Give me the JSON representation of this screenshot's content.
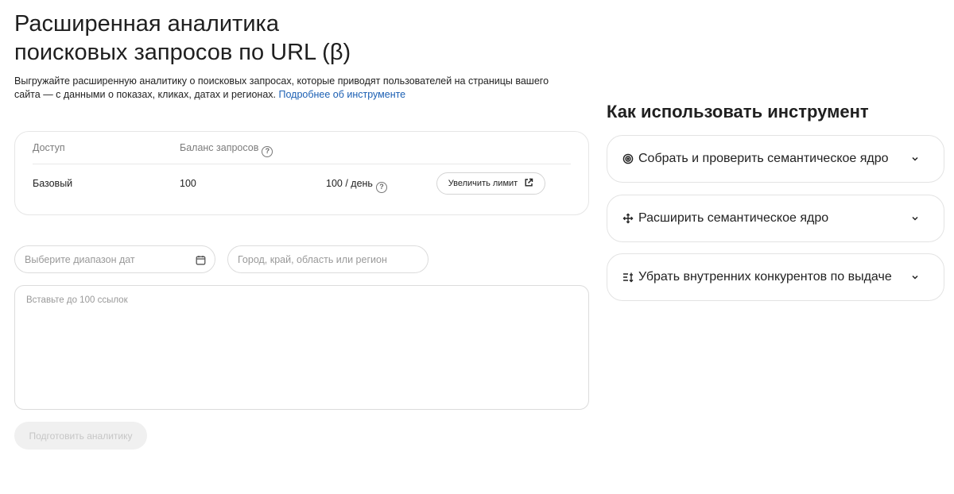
{
  "page": {
    "title_line1": "Расширенная аналитика",
    "title_line2": "поисковых запросов по URL (β)",
    "description": "Выгружайте расширенную аналитику о поисковых запросах, которые приводят пользователей на страницы вашего сайта — с данными о показах, кликах, датах и регионах.",
    "more_link": "Подробнее об инструменте"
  },
  "access_card": {
    "header_access": "Доступ",
    "header_balance": "Баланс запросов",
    "access_value": "Базовый",
    "balance_value": "100",
    "per_day": "100 / день",
    "increase_button": "Увеличить лимит"
  },
  "form": {
    "date_placeholder": "Выберите диапазон дат",
    "region_placeholder": "Город, край, область или регион",
    "links_placeholder": "Вставьте до 100 ссылок",
    "submit_label": "Подготовить аналитику"
  },
  "sidebar": {
    "title": "Как использовать инструмент",
    "items": [
      {
        "label": "Собрать и проверить семантическое ядро",
        "icon": "target-icon"
      },
      {
        "label": "Расширить семантическое ядро",
        "icon": "expand-arrows-icon"
      },
      {
        "label": "Убрать внутренних конкурентов по выдаче",
        "icon": "sort-list-icon"
      }
    ]
  },
  "colors": {
    "link": "#1b5fb3",
    "border": "#e3e3e3",
    "disabled_bg": "#f0f0f0"
  }
}
